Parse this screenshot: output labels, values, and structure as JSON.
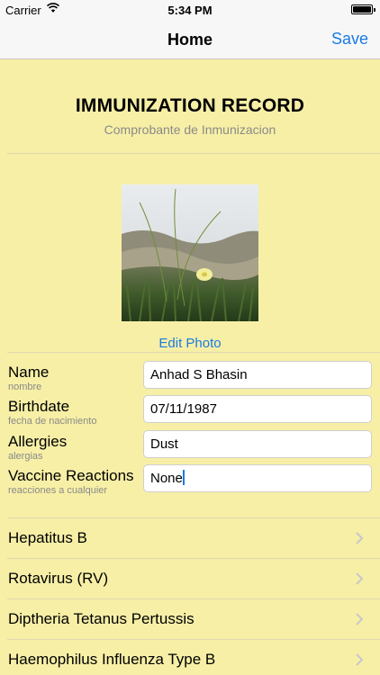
{
  "status_bar": {
    "carrier": "Carrier",
    "time": "5:34 PM"
  },
  "nav": {
    "title": "Home",
    "save_label": "Save"
  },
  "header": {
    "title": "IMMUNIZATION RECORD",
    "subtitle": "Comprobante de Inmunizacion"
  },
  "photo": {
    "edit_label": "Edit Photo"
  },
  "fields": [
    {
      "label": "Name",
      "sublabel": "nombre",
      "value": "Anhad S Bhasin"
    },
    {
      "label": "Birthdate",
      "sublabel": "fecha de nacimiento",
      "value": "07/11/1987"
    },
    {
      "label": "Allergies",
      "sublabel": "alergias",
      "value": "Dust"
    },
    {
      "label": "Vaccine Reactions",
      "sublabel": "reacciones a cualquier",
      "value": "None"
    }
  ],
  "vaccines": [
    {
      "label": "Hepatitus B"
    },
    {
      "label": "Rotavirus (RV)"
    },
    {
      "label": "Diptheria Tetanus Pertussis"
    },
    {
      "label": "Haemophilus Influenza Type B"
    }
  ],
  "colors": {
    "background": "#f7efa6",
    "accent": "#1a7be3",
    "bar": "#f7f7f7"
  }
}
